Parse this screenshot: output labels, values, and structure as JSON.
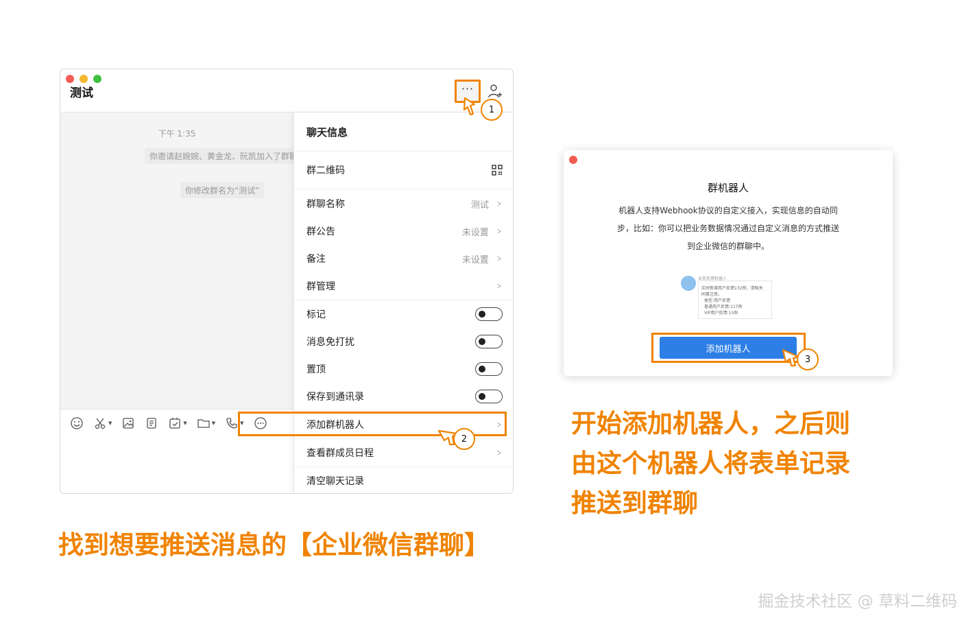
{
  "chat_window": {
    "title": "测试",
    "more_label": "···",
    "system_time": "下午 1:35",
    "system_msg_1": "你邀请赵婉婉、黄金龙、阮凯加入了群聊",
    "system_msg_2": "你修改群名为“测试”"
  },
  "menu": {
    "header": "聊天信息",
    "qr_label": "群二维码",
    "group_name_label": "群聊名称",
    "group_name_value": "测试",
    "notice_label": "群公告",
    "notice_value": "未设置",
    "remark_label": "备注",
    "remark_value": "未设置",
    "manage_label": "群管理",
    "mark_label": "标记",
    "mute_label": "消息免打扰",
    "pin_label": "置顶",
    "save_label": "保存到通讯录",
    "robot_label": "添加群机器人",
    "schedule_label": "查看群成员日程",
    "clear_label": "清空聊天记录"
  },
  "callouts": {
    "one": "1",
    "two": "2",
    "three": "3"
  },
  "robot_dialog": {
    "title": "群机器人",
    "desc_1": "机器人支持Webhook协议的自定义接入，实现信息的自动同",
    "desc_2": "步，比如：你可以把业务数据情况通过自定义消息的方式推送",
    "desc_3": "到企业微信的群聊中。",
    "preview_name": "业务反馈机器人",
    "preview_line_1": "实时新增用户反馈132例，请相关",
    "preview_line_2": "同事注意。",
    "preview_line_3": "类型:用户反馈",
    "preview_line_4": "普通用户反馈:117例",
    "preview_line_5": "VIP用户反馈:15例",
    "add_button": "添加机器人"
  },
  "captions": {
    "left": "找到想要推送消息的【企业微信群聊】",
    "right_1": "开始添加机器人，之后则",
    "right_2": "由这个机器人将表单记录",
    "right_3": "推送到群聊"
  },
  "watermark": "掘金技术社区 @ 草料二维码",
  "colors": {
    "accent": "#f08300",
    "button_blue": "#2d7fe6",
    "close_red": "#f25c54"
  }
}
